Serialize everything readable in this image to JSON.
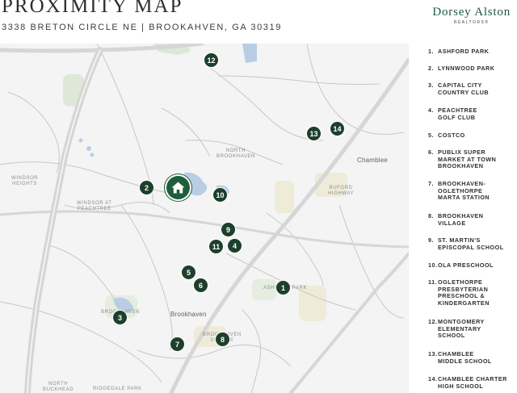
{
  "header": {
    "title": "PROXIMITY MAP",
    "address": "3338 BRETON CIRCLE NE  |  BROOKAHVEN, GA 30319"
  },
  "brand": {
    "name": "Dorsey Alston",
    "sub": "REALTORS®"
  },
  "colors": {
    "marker": "#1d3f2c",
    "home_marker": "#1d5e3c",
    "brand": "#1f5a3e",
    "water": "#b9cde6",
    "park": "#dde8d6",
    "highway": "#dcdcdc"
  },
  "map": {
    "home_icon": "house-icon",
    "labels": {
      "north_brookhaven": "NORTH\nBROOKHAVEN",
      "chamblee": "Chamblee",
      "buford_highway": "BUFORD\nHIGHWAY",
      "windsor_heights": "WINDSOR\nHEIGHTS",
      "windsor_at_peachtree": "WINDSOR AT\nPEACHTREE",
      "ashford_park": "ASHFORD PARK",
      "brookhaven": "Brookhaven",
      "brookhaven_fields": "BROOKHAVEN",
      "brookhaven_village": "BROOKHAVEN\nVILLAGE",
      "north_buckhead": "NORTH\nBUCKHEAD",
      "ridgedale_park": "RIDGEDALE PARK"
    },
    "markers": [
      "1",
      "2",
      "3",
      "4",
      "5",
      "6",
      "7",
      "8",
      "9",
      "10",
      "11",
      "12",
      "13",
      "14"
    ]
  },
  "legend": [
    {
      "num": "1.",
      "name": "ASHFORD PARK"
    },
    {
      "num": "2.",
      "name": "LYNNWOOD PARK"
    },
    {
      "num": "3.",
      "name": "CAPITAL CITY\nCOUNTRY CLUB"
    },
    {
      "num": "4.",
      "name": "PEACHTREE\nGOLF CLUB"
    },
    {
      "num": "5.",
      "name": "COSTCO"
    },
    {
      "num": "6.",
      "name": "PUBLIX SUPER\nMARKET AT TOWN\nBROOKHAVEN"
    },
    {
      "num": "7.",
      "name": "BROOKHAVEN-\nOGLETHORPE\nMARTA STATION"
    },
    {
      "num": "8.",
      "name": "BROOKHAVEN\nVILLAGE"
    },
    {
      "num": "9.",
      "name": "ST. MARTIN'S\nEPISCOPAL SCHOOL"
    },
    {
      "num": "10.",
      "name": "OLA PRESCHOOL"
    },
    {
      "num": "11.",
      "name": "OGLETHORPE\nPRESBYTERIAN\nPRESCHOOL &\nKINDERGARTEN"
    },
    {
      "num": "12.",
      "name": "MONTGOMERY\nELEMENTARY\nSCHOOL"
    },
    {
      "num": "13.",
      "name": "CHAMBLEE\nMIDDLE SCHOOL"
    },
    {
      "num": "14.",
      "name": "CHAMBLEE CHARTER\nHIGH SCHOOL"
    }
  ]
}
